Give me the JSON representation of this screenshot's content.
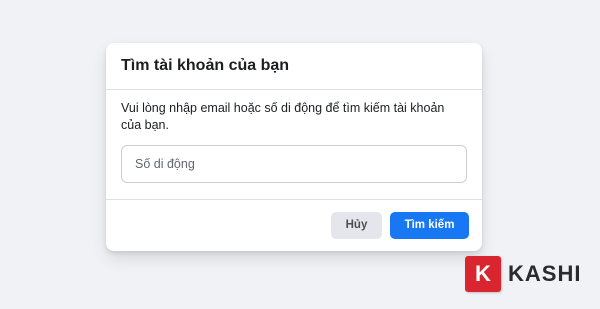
{
  "dialog": {
    "title": "Tìm tài khoản của bạn",
    "description": "Vui lòng nhập email hoặc số di động để tìm kiếm tài khoản của bạn.",
    "input": {
      "placeholder": "Số di động",
      "value": ""
    },
    "cancel_label": "Hủy",
    "search_label": "Tìm kiếm"
  },
  "watermark": {
    "badge_letter": "K",
    "text": "KASHI"
  },
  "colors": {
    "background": "#f0f2f5",
    "primary_button": "#1877f2",
    "secondary_button": "#e4e6eb",
    "brand_red": "#d9252f"
  }
}
